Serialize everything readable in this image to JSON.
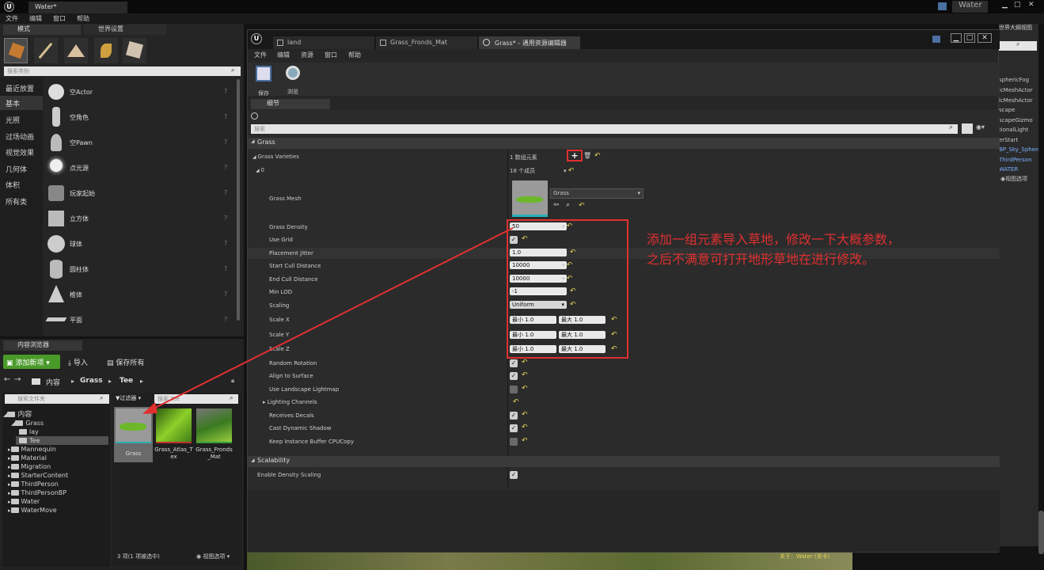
{
  "window_tab": "Water*",
  "window_title_right": "Water",
  "main_menu": [
    "文件",
    "编辑",
    "窗口",
    "帮助"
  ],
  "modes_tabs": [
    "模式",
    "世界设置"
  ],
  "modes_search_placeholder": "搜索类别",
  "categories": [
    "最近放置",
    "基本",
    "光照",
    "过场动画",
    "视觉效果",
    "几何体",
    "体积",
    "所有类"
  ],
  "actors": [
    "空Actor",
    "空角色",
    "空Pawn",
    "点光源",
    "玩家起始",
    "立方体",
    "球体",
    "圆柱体",
    "椎体",
    "平面"
  ],
  "content_browser": {
    "tab": "内容浏览器",
    "add_new": "添加新项",
    "import": "导入",
    "save_all": "保存所有",
    "breadcrumb": [
      "内容",
      "Grass",
      "Tee"
    ],
    "search_folders_placeholder": "搜索文件夹",
    "filters": "过滤器",
    "search_assets_placeholder": "搜索 Tee",
    "tree": [
      {
        "label": "内容",
        "level": 0
      },
      {
        "label": "Grass",
        "level": 1
      },
      {
        "label": "lay",
        "level": 2
      },
      {
        "label": "Tee",
        "level": 2
      },
      {
        "label": "Mannequin",
        "level": 1
      },
      {
        "label": "Material",
        "level": 1
      },
      {
        "label": "Migration",
        "level": 1
      },
      {
        "label": "StarterContent",
        "level": 1
      },
      {
        "label": "ThirdPerson",
        "level": 1
      },
      {
        "label": "ThirdPersonBP",
        "level": 1
      },
      {
        "label": "Water",
        "level": 1
      },
      {
        "label": "WaterMove",
        "level": 1
      }
    ],
    "assets": [
      "Grass",
      "Grass_Atlas_Tex",
      "Grass_Fronds_Mat"
    ],
    "status": "3 项(1 项被选中)",
    "view_options": "视图选项"
  },
  "editor": {
    "tabs": [
      "land",
      "Grass_Fronds_Mat",
      "Grass* - 通用资源编辑器"
    ],
    "menu": [
      "文件",
      "编辑",
      "资源",
      "窗口",
      "帮助"
    ],
    "toolbar": [
      "保存",
      "浏览"
    ],
    "details_tab": "细节",
    "search_placeholder": "搜索",
    "section_grass": "Grass",
    "grass_varieties": "Grass Varieties",
    "array_count": "1 数组元素",
    "index0": "0",
    "members": "18 个成员",
    "grass_mesh": "Grass Mesh",
    "mesh_name": "Grass",
    "props": {
      "grass_density": {
        "label": "Grass Density",
        "value": "50"
      },
      "use_grid": {
        "label": "Use Grid",
        "checked": true
      },
      "placement_jitter": {
        "label": "Placement Jitter",
        "value": "1.0"
      },
      "start_cull": {
        "label": "Start Cull Distance",
        "value": "10000"
      },
      "end_cull": {
        "label": "End Cull Distance",
        "value": "10000"
      },
      "min_lod": {
        "label": "Min LOD",
        "value": "-1"
      },
      "scaling": {
        "label": "Scaling",
        "value": "Uniform"
      },
      "scale_x": {
        "label": "Scale X",
        "min": "最小  1.0",
        "max": "最大  1.0"
      },
      "scale_y": {
        "label": "Scale Y",
        "min": "最小  1.0",
        "max": "最大  1.0"
      },
      "scale_z": {
        "label": "Scale Z",
        "min": "最小  1.0",
        "max": "最大  1.0"
      },
      "random_rotation": {
        "label": "Random Rotation",
        "checked": true
      },
      "align_surface": {
        "label": "Align to Surface",
        "checked": true
      },
      "use_landscape": {
        "label": "Use Landscape Lightmap",
        "checked": false
      },
      "lighting_channels": {
        "label": "Lighting Channels"
      },
      "receives_decals": {
        "label": "Receives Decals",
        "checked": true
      },
      "cast_shadow": {
        "label": "Cast Dynamic Shadow",
        "checked": true
      },
      "keep_buffer": {
        "label": "Keep Instance Buffer CPUCopy",
        "checked": false
      }
    },
    "section_scalability": "Scalability",
    "enable_density": {
      "label": "Enable Density Scaling",
      "checked": true
    }
  },
  "annotation": [
    "添加一组元素导入草地，修改一下大概参数，",
    "之后不满意可打开地形草地在进行修改。"
  ],
  "outliner": {
    "title": "世界大纲视图",
    "items": [
      "sphericFog",
      "icMeshActor",
      "icMeshActor",
      "scape",
      "scapeGizmo",
      "tionalLight",
      "erStart",
      "BP_Sky_Sphere",
      "ThirdPerson",
      "WATER"
    ],
    "view_options": "视图选项"
  },
  "status_right": "关于：Water (关卡)",
  "colors": {
    "annotation": "#e03030",
    "accent": "#e8d55a",
    "add_green": "#4a9a2a"
  }
}
